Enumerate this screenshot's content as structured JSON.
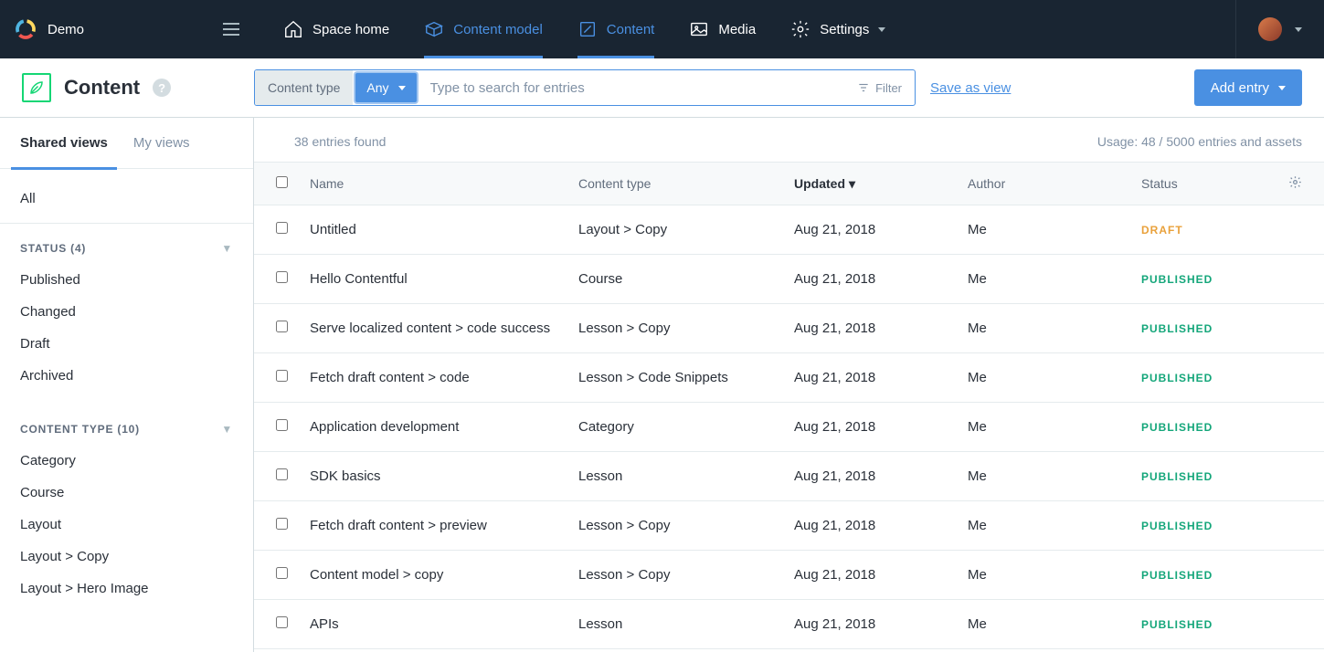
{
  "space_name": "Demo",
  "nav": {
    "home": "Space home",
    "model": "Content model",
    "content": "Content",
    "media": "Media",
    "settings": "Settings"
  },
  "page": {
    "title": "Content",
    "help": "?"
  },
  "search": {
    "ct_label": "Content type",
    "ct_value": "Any",
    "placeholder": "Type to search for entries",
    "filter": "Filter",
    "save_view": "Save as view"
  },
  "add_entry": "Add entry",
  "sidebar": {
    "tabs": {
      "shared": "Shared views",
      "my": "My views"
    },
    "all": "All",
    "status_header": "STATUS (4)",
    "status_items": [
      "Published",
      "Changed",
      "Draft",
      "Archived"
    ],
    "ct_header": "CONTENT TYPE (10)",
    "ct_items": [
      "Category",
      "Course",
      "Layout",
      "Layout > Copy",
      "Layout > Hero Image"
    ]
  },
  "meta": {
    "found": "38 entries found",
    "usage": "Usage: 48 / 5000 entries and assets"
  },
  "columns": {
    "name": "Name",
    "ct": "Content type",
    "updated": "Updated",
    "author": "Author",
    "status": "Status"
  },
  "rows": [
    {
      "name": "Untitled",
      "ct": "Layout > Copy",
      "updated": "Aug 21, 2018",
      "author": "Me",
      "status": "DRAFT"
    },
    {
      "name": "Hello Contentful",
      "ct": "Course",
      "updated": "Aug 21, 2018",
      "author": "Me",
      "status": "PUBLISHED"
    },
    {
      "name": "Serve localized content > code success",
      "ct": "Lesson > Copy",
      "updated": "Aug 21, 2018",
      "author": "Me",
      "status": "PUBLISHED"
    },
    {
      "name": "Fetch draft content > code",
      "ct": "Lesson > Code Snippets",
      "updated": "Aug 21, 2018",
      "author": "Me",
      "status": "PUBLISHED"
    },
    {
      "name": "Application development",
      "ct": "Category",
      "updated": "Aug 21, 2018",
      "author": "Me",
      "status": "PUBLISHED"
    },
    {
      "name": "SDK basics",
      "ct": "Lesson",
      "updated": "Aug 21, 2018",
      "author": "Me",
      "status": "PUBLISHED"
    },
    {
      "name": "Fetch draft content > preview",
      "ct": "Lesson > Copy",
      "updated": "Aug 21, 2018",
      "author": "Me",
      "status": "PUBLISHED"
    },
    {
      "name": "Content model > copy",
      "ct": "Lesson > Copy",
      "updated": "Aug 21, 2018",
      "author": "Me",
      "status": "PUBLISHED"
    },
    {
      "name": "APIs",
      "ct": "Lesson",
      "updated": "Aug 21, 2018",
      "author": "Me",
      "status": "PUBLISHED"
    }
  ]
}
